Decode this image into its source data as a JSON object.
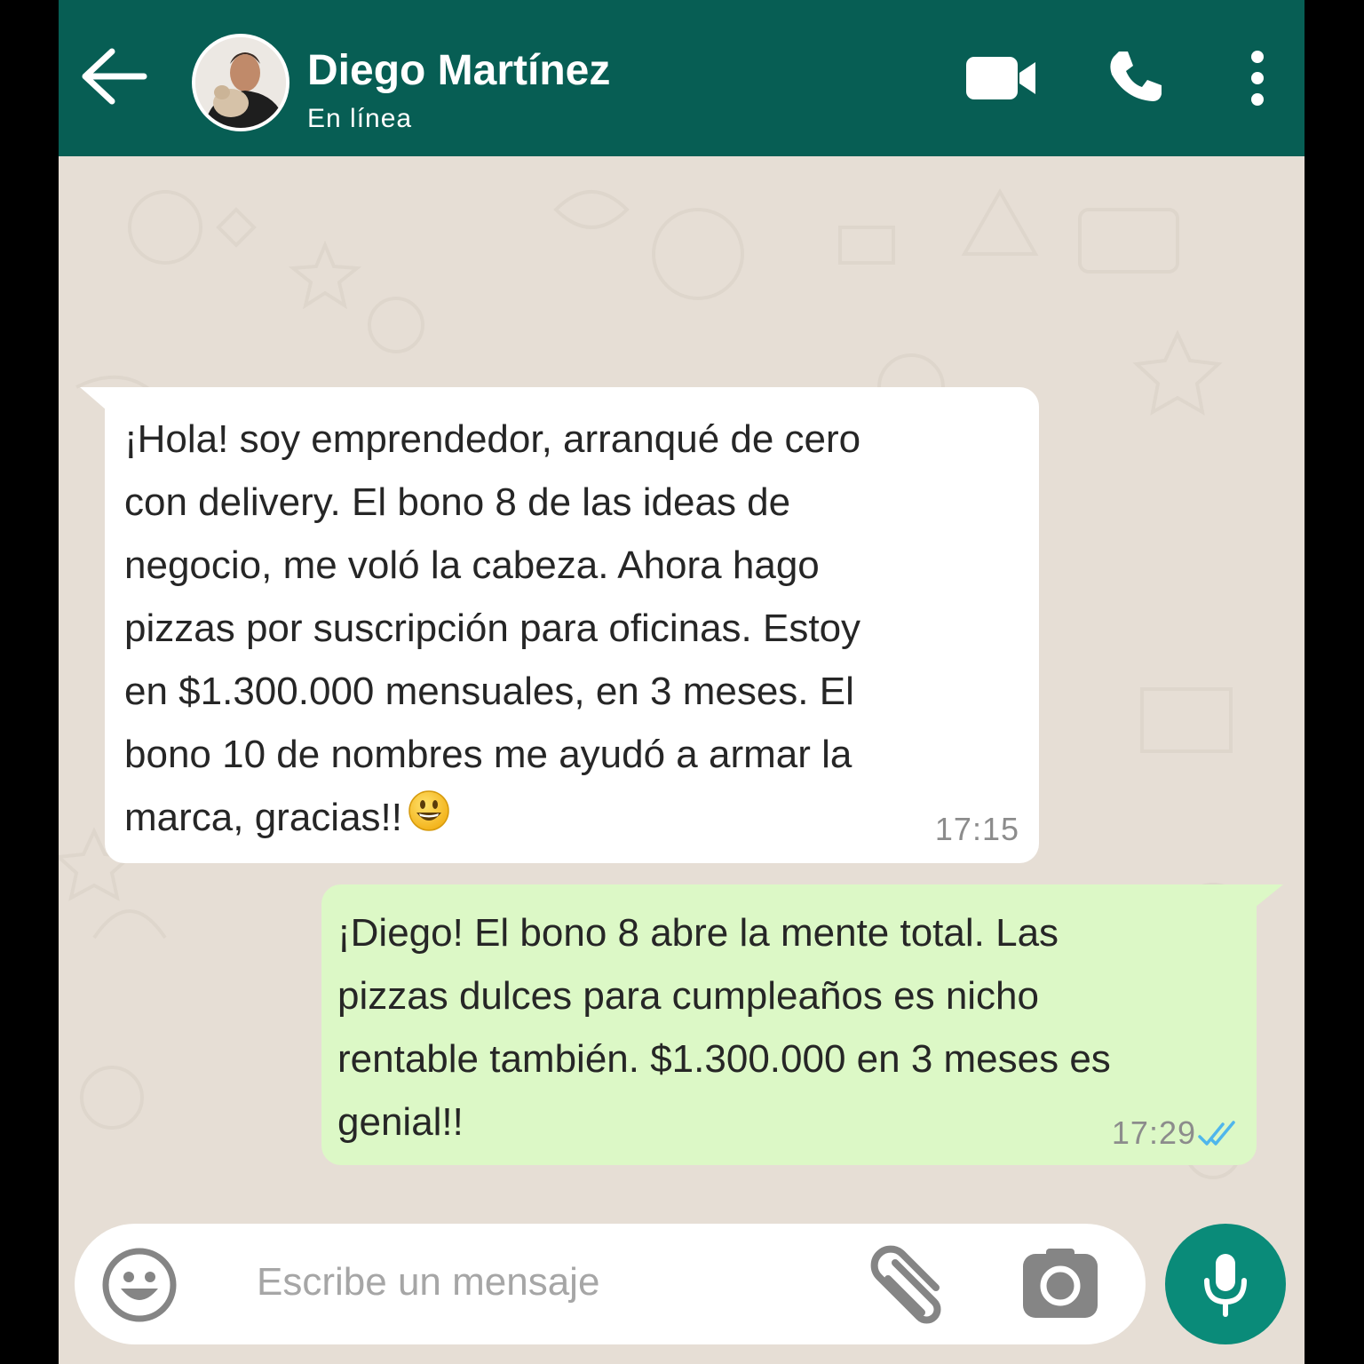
{
  "header": {
    "contact_name": "Diego Martínez",
    "status": "En línea",
    "back_icon": "arrow-left-icon",
    "video_icon": "video-camera-icon",
    "call_icon": "phone-icon",
    "menu_icon": "more-vertical-icon"
  },
  "messages": [
    {
      "direction": "incoming",
      "text": "¡Hola! soy emprendedor, arranqué de cero\ncon delivery. El bono 8 de las ideas de\nnegocio, me voló la cabeza. Ahora hago\npizzas por suscripción para oficinas. Estoy\nen $1.300.000 mensuales, en 3 meses. El\nbono 10 de nombres me ayudó a armar la\nmarca, gracias!!",
      "emoji": "smiling-face-icon",
      "time": "17:15"
    },
    {
      "direction": "outgoing",
      "text": "¡Diego! El bono 8 abre la mente total. Las\npizzas dulces para cumpleaños es nicho\nrentable también. $1.300.000 en 3 meses es\ngenial!!",
      "time": "17:29",
      "status_icon": "double-check-read-icon"
    }
  ],
  "composer": {
    "placeholder": "Escribe un mensaje",
    "emoji_icon": "emoji-icon",
    "attach_icon": "paperclip-icon",
    "camera_icon": "camera-icon",
    "mic_icon": "microphone-icon"
  },
  "colors": {
    "header": "#075e54",
    "chat_background": "#e6ded5",
    "incoming_bubble": "#ffffff",
    "outgoing_bubble": "#dcf8c6",
    "mic_button": "#0a8b79",
    "read_ticks": "#4fb6ec"
  }
}
